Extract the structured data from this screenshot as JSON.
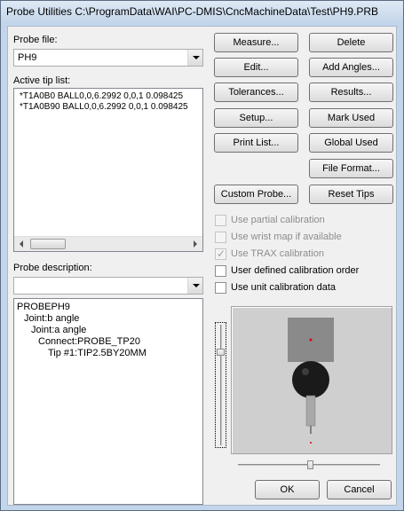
{
  "window": {
    "title": "Probe Utilities  C:\\ProgramData\\WAI\\PC-DMIS\\CncMachineData\\Test\\PH9.PRB"
  },
  "probe_file": {
    "label": "Probe file:",
    "value": "PH9"
  },
  "active_tip_list": {
    "label": "Active tip list:",
    "items": [
      "*T1A0B0  BALL0,0,6.2992  0,0,1  0.098425",
      "*T1A0B90  BALL0,0,6.2992  0,0,1  0.098425"
    ]
  },
  "probe_description": {
    "label": "Probe description:",
    "value": "",
    "tree": [
      "PROBEPH9",
      "Joint:b angle",
      "Joint:a angle",
      "Connect:PROBE_TP20",
      "Tip #1:TIP2.5BY20MM"
    ]
  },
  "buttons": {
    "measure": "Measure...",
    "delete": "Delete",
    "edit": "Edit...",
    "add_angles": "Add Angles...",
    "tolerances": "Tolerances...",
    "results": "Results...",
    "setup": "Setup...",
    "mark_used": "Mark Used",
    "print_list": "Print List...",
    "global_used": "Global Used",
    "file_format": "File Format...",
    "custom_probe": "Custom Probe...",
    "reset_tips": "Reset Tips",
    "ok": "OK",
    "cancel": "Cancel"
  },
  "options": [
    {
      "label": "Use partial calibration",
      "checked": false,
      "enabled": false
    },
    {
      "label": "Use wrist map if available",
      "checked": false,
      "enabled": false
    },
    {
      "label": "Use TRAX calibration",
      "checked": true,
      "enabled": false
    },
    {
      "label": "User defined calibration order",
      "checked": false,
      "enabled": true
    },
    {
      "label": "Use unit calibration data",
      "checked": false,
      "enabled": true
    }
  ],
  "colors": {
    "title_bar": "#c4d6ea",
    "preview_background": "#cfcfcf",
    "probe_head": "#8a8a8a",
    "probe_ball": "#1a1a1a",
    "marker": "#e00000"
  }
}
